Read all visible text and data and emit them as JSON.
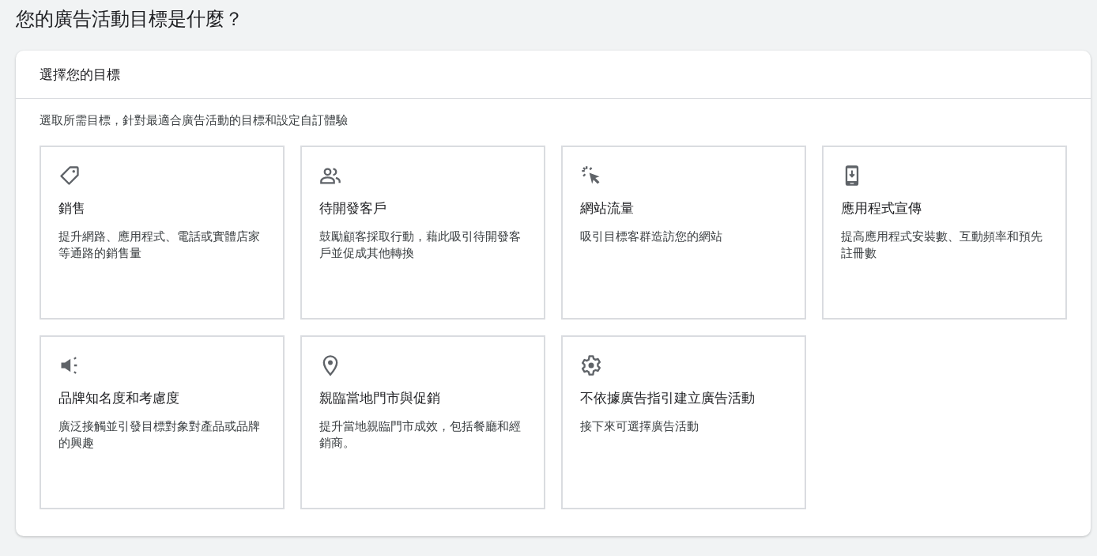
{
  "page_title": "您的廣告活動目標是什麼？",
  "panel": {
    "header": "選擇您的目標",
    "intro": "選取所需目標，針對最適合廣告活動的目標和設定自訂體驗",
    "goals": [
      {
        "kind": "tag",
        "title": "銷售",
        "description": "提升網路、應用程式、電話或實體店家等通路的銷售量"
      },
      {
        "kind": "people",
        "title": "待開發客戶",
        "description": "鼓勵顧客採取行動，藉此吸引待開發客戶並促成其他轉換"
      },
      {
        "kind": "click",
        "title": "網站流量",
        "description": "吸引目標客群造訪您的網站"
      },
      {
        "kind": "phone",
        "title": "應用程式宣傳",
        "description": "提高應用程式安裝數、互動頻率和預先註冊數"
      },
      {
        "kind": "megaphone",
        "title": "品牌知名度和考慮度",
        "description": "廣泛接觸並引發目標對象對產品或品牌的興趣"
      },
      {
        "kind": "pin",
        "title": "親臨當地門市與促銷",
        "description": "提升當地親臨門市成效，包括餐廳和經銷商。"
      },
      {
        "kind": "gear",
        "title": "不依據廣告指引建立廣告活動",
        "description": "接下來可選擇廣告活動"
      }
    ]
  }
}
